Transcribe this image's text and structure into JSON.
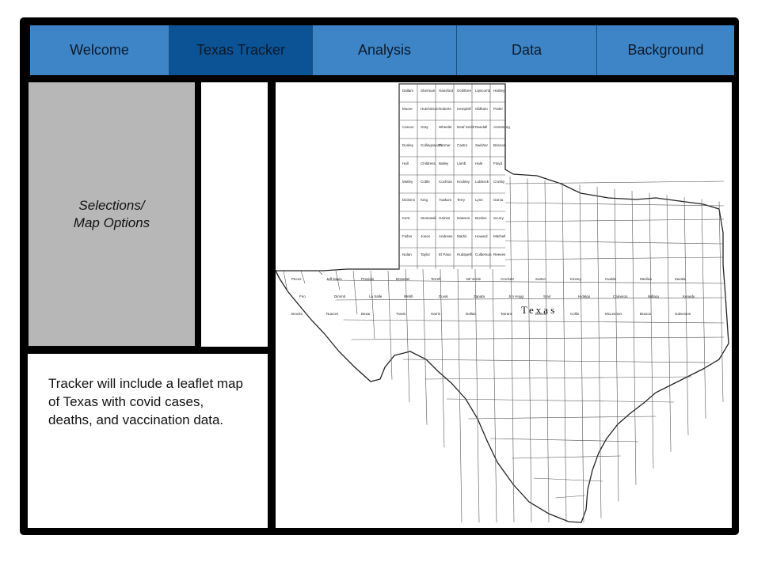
{
  "nav": {
    "tabs": [
      {
        "label": "Welcome",
        "active": false
      },
      {
        "label": "Texas Tracker",
        "active": true
      },
      {
        "label": "Analysis",
        "active": false
      },
      {
        "label": "Data",
        "active": false
      },
      {
        "label": "Background",
        "active": false
      }
    ]
  },
  "sidebar": {
    "line1": "Selections/",
    "line2": "Map Options"
  },
  "description": "Tracker will include a leaflet map of Texas with covid cases, deaths, and vaccination data.",
  "map": {
    "state_label": "Texas",
    "county_labels": [
      "Dallam",
      "Sherman",
      "Hansford",
      "Ochiltree",
      "Lipscomb",
      "Hartley",
      "Moore",
      "Hutchinson",
      "Roberts",
      "Hemphill",
      "Oldham",
      "Potter",
      "Carson",
      "Gray",
      "Wheeler",
      "Deaf Smith",
      "Randall",
      "Armstrong",
      "Donley",
      "Collingsworth",
      "Parmer",
      "Castro",
      "Swisher",
      "Briscoe",
      "Hall",
      "Childress",
      "Bailey",
      "Lamb",
      "Hale",
      "Floyd",
      "Motley",
      "Cottle",
      "Cochran",
      "Hockley",
      "Lubbock",
      "Crosby",
      "Dickens",
      "King",
      "Yoakum",
      "Terry",
      "Lynn",
      "Garza",
      "Kent",
      "Stonewall",
      "Gaines",
      "Dawson",
      "Borden",
      "Scurry",
      "Fisher",
      "Jones",
      "Andrews",
      "Martin",
      "Howard",
      "Mitchell",
      "Nolan",
      "Taylor",
      "El Paso",
      "Hudspeth",
      "Culberson",
      "Reeves",
      "Pecos",
      "Jeff Davis",
      "Presidio",
      "Brewster",
      "Terrell",
      "Val Verde",
      "Crockett",
      "Sutton",
      "Kinney",
      "Uvalde",
      "Medina",
      "Zavala",
      "Frio",
      "Dimmit",
      "La Salle",
      "Webb",
      "Duval",
      "Zapata",
      "Jim Hogg",
      "Starr",
      "Hidalgo",
      "Cameron",
      "Willacy",
      "Kenedy",
      "Brooks",
      "Nueces",
      "Bexar",
      "Travis",
      "Harris",
      "Dallas",
      "Tarrant",
      "Denton",
      "Collin",
      "McLennan",
      "Brazos",
      "Galveston"
    ]
  }
}
